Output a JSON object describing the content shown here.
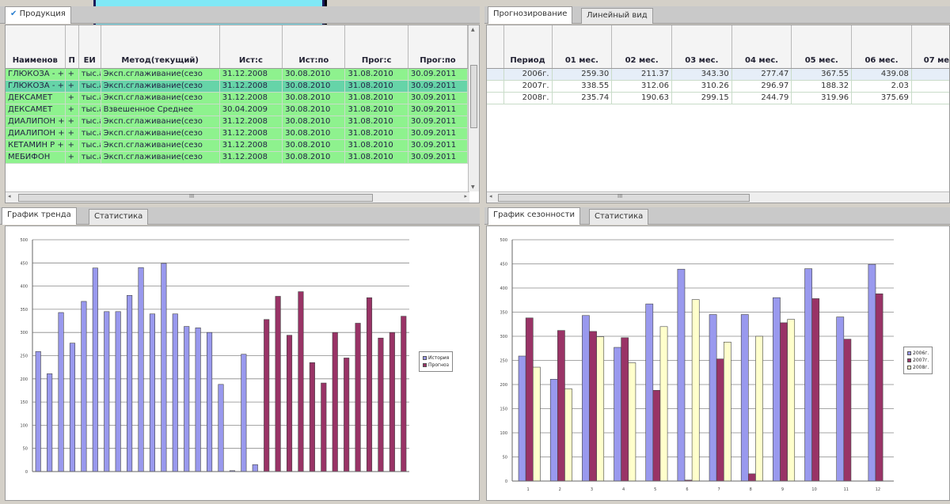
{
  "left_panel": {
    "tab_products": "Продукция",
    "columns": [
      "Наименов",
      "П",
      "ЕИ",
      "Метод(текущий)",
      "Ист:с",
      "Ист:по",
      "Прог:с",
      "Прог:по"
    ],
    "rows": [
      [
        "ГЛЮКОЗА - +",
        "+",
        "тыс.а",
        "Эксп.сглаживание(сезо",
        "31.12.2008",
        "30.08.2010",
        "31.08.2010",
        "30.09.2011"
      ],
      [
        "ГЛЮКОЗА - +",
        "+",
        "тыс.а",
        "Эксп.сглаживание(сезо",
        "31.12.2008",
        "30.08.2010",
        "31.08.2010",
        "30.09.2011"
      ],
      [
        "ДЕКСАМЕТ",
        "+",
        "тыс.а",
        "Эксп.сглаживание(сезо",
        "31.12.2008",
        "30.08.2010",
        "31.08.2010",
        "30.09.2011"
      ],
      [
        "ДЕКСАМЕТ",
        "+",
        "тыс.а",
        "Взвешенное Среднее",
        "30.04.2009",
        "30.08.2010",
        "31.08.2010",
        "30.09.2011"
      ],
      [
        "ДИАЛИПОН +",
        "+",
        "тыс.а",
        "Эксп.сглаживание(сезо",
        "31.12.2008",
        "30.08.2010",
        "31.08.2010",
        "30.09.2011"
      ],
      [
        "ДИАЛИПОН +",
        "+",
        "тыс.а",
        "Эксп.сглаживание(сезо",
        "31.12.2008",
        "30.08.2010",
        "31.08.2010",
        "30.09.2011"
      ],
      [
        "КЕТАМИН Р +",
        "+",
        "тыс.а",
        "Эксп.сглаживание(сезо",
        "31.12.2008",
        "30.08.2010",
        "31.08.2010",
        "30.09.2011"
      ],
      [
        "МЕБИФОН",
        "+",
        "тыс.а",
        "Эксп.сглаживание(сезо",
        "31.12.2008",
        "30.08.2010",
        "31.08.2010",
        "30.09.2011"
      ]
    ],
    "selected_row": 1,
    "scroll_marker": "III"
  },
  "right_panel": {
    "tab_forecast": "Прогнозирование",
    "tab_linear": "Линейный вид",
    "columns": [
      "Период",
      "01 мес.",
      "02 мес.",
      "03 мес.",
      "04 мес.",
      "05 мес.",
      "06 мес.",
      "07 ме"
    ],
    "rows": [
      [
        "2006г.",
        "259.30",
        "211.37",
        "343.30",
        "277.47",
        "367.55",
        "439.08",
        "34"
      ],
      [
        "2007г.",
        "338.55",
        "312.06",
        "310.26",
        "296.97",
        "188.32",
        "2.03",
        "25"
      ],
      [
        "2008г.",
        "235.74",
        "190.63",
        "299.15",
        "244.79",
        "319.96",
        "375.69",
        "28"
      ]
    ],
    "selected_row": 0,
    "scroll_marker": "III"
  },
  "bottom_left": {
    "tab_trend": "График тренда",
    "tab_stats": "Статистика"
  },
  "bottom_right": {
    "tab_seasonality": "График сезонности",
    "tab_stats": "Статистика"
  },
  "chart_data": [
    {
      "type": "bar",
      "ylim": [
        0,
        500
      ],
      "yticks": [
        0,
        50,
        100,
        150,
        200,
        250,
        300,
        350,
        400,
        450,
        500
      ],
      "series": [
        {
          "name": "История",
          "color": "#9999ee",
          "values": [
            259,
            211,
            343,
            277,
            367,
            439,
            345,
            345,
            380,
            440,
            340,
            449,
            340,
            313,
            310,
            300,
            188,
            2,
            253,
            15,
            null,
            null,
            null,
            null,
            null,
            null,
            null,
            null,
            null,
            null,
            null,
            null,
            null
          ]
        },
        {
          "name": "Прогноз",
          "color": "#993366",
          "values": [
            null,
            null,
            null,
            null,
            null,
            null,
            null,
            null,
            null,
            null,
            null,
            null,
            null,
            null,
            null,
            null,
            null,
            null,
            null,
            null,
            328,
            378,
            294,
            388,
            235,
            191,
            300,
            245,
            320,
            375,
            288,
            300,
            335
          ]
        }
      ]
    },
    {
      "type": "bar",
      "categories": [
        "1",
        "2",
        "3",
        "4",
        "5",
        "6",
        "7",
        "8",
        "9",
        "10",
        "11",
        "12"
      ],
      "ylim": [
        0,
        500
      ],
      "yticks": [
        0,
        50,
        100,
        150,
        200,
        250,
        300,
        350,
        400,
        450,
        500
      ],
      "series": [
        {
          "name": "2006г.",
          "color": "#9999ee",
          "values": [
            259,
            211,
            343,
            277,
            367,
            439,
            345,
            345,
            380,
            440,
            340,
            449
          ]
        },
        {
          "name": "2007г.",
          "color": "#993366",
          "values": [
            338,
            312,
            310,
            297,
            188,
            2,
            253,
            15,
            328,
            378,
            294,
            388
          ]
        },
        {
          "name": "2008г.",
          "color": "#ffffcc",
          "values": [
            236,
            191,
            299,
            245,
            320,
            376,
            288,
            300,
            335,
            null,
            null,
            null
          ]
        }
      ]
    }
  ]
}
